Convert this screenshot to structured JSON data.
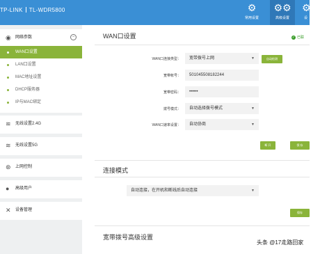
{
  "header": {
    "brand": "TP-LINK",
    "model": "TL-WDR5800",
    "buttons": [
      {
        "label": "常用设置",
        "icon": "gear-icon"
      },
      {
        "label": "高级设置",
        "icon": "gears-icon"
      },
      {
        "label": "设",
        "icon": "gear-icon"
      }
    ]
  },
  "sidebar": {
    "network_group": {
      "label": "网络参数",
      "items": [
        "WAN口设置",
        "LAN口设置",
        "MAC地址设置",
        "DHCP服务器",
        "IP与MAC绑定"
      ]
    },
    "groups": [
      "无线设置2.4G",
      "无线设置5G",
      "上网控制",
      "高级用户",
      "设备管理"
    ]
  },
  "main": {
    "wan_section": {
      "title": "WAN口设置",
      "status": "已联",
      "fields": {
        "conn_type_label": "WAN口连接类型：",
        "conn_type_value": "宽带拨号上网",
        "detect_button": "自动检测",
        "account_label": "宽带帐号：",
        "account_value": "501045508182244",
        "password_label": "宽带密码：",
        "password_value": "••••••",
        "dial_mode_label": "拨号模式：",
        "dial_mode_value": "自动选择拨号模式",
        "speed_label": "WAN口速率设置：",
        "speed_value": "自动协商"
      },
      "connect_button": "断 开",
      "save_button": "保 存"
    },
    "mode_section": {
      "title": "连接模式",
      "mode_value": "自动连接，在开机和断线后自动连接",
      "save_button": "保存"
    },
    "adv_section": {
      "title": "宽带拨号高级设置"
    }
  },
  "watermark": "头条 @17走路回家"
}
